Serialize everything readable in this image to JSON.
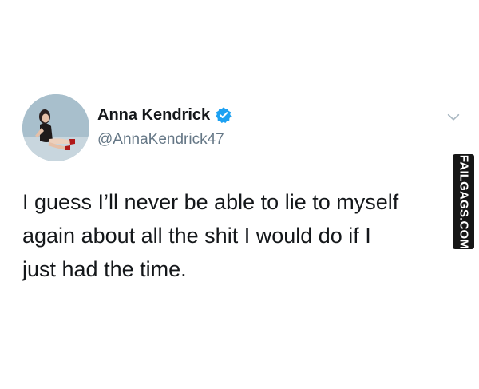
{
  "tweet": {
    "display_name": "Anna Kendrick",
    "handle": "@AnnaKendrick47",
    "verified": true,
    "text_lines": [
      "I guess I’ll never be able to lie to myself",
      "again about all the shit I would do if I",
      "just had the time."
    ]
  },
  "icons": {
    "verified": "verified-badge-icon",
    "more": "chevron-down-icon",
    "avatar": "profile-photo"
  },
  "colors": {
    "verified_blue": "#1da1f2",
    "handle_gray": "#657786",
    "text": "#14171a",
    "chevron": "#aab8c2",
    "watermark_bg": "#161616"
  },
  "watermark": {
    "text": "FAILGAGS.COM"
  }
}
